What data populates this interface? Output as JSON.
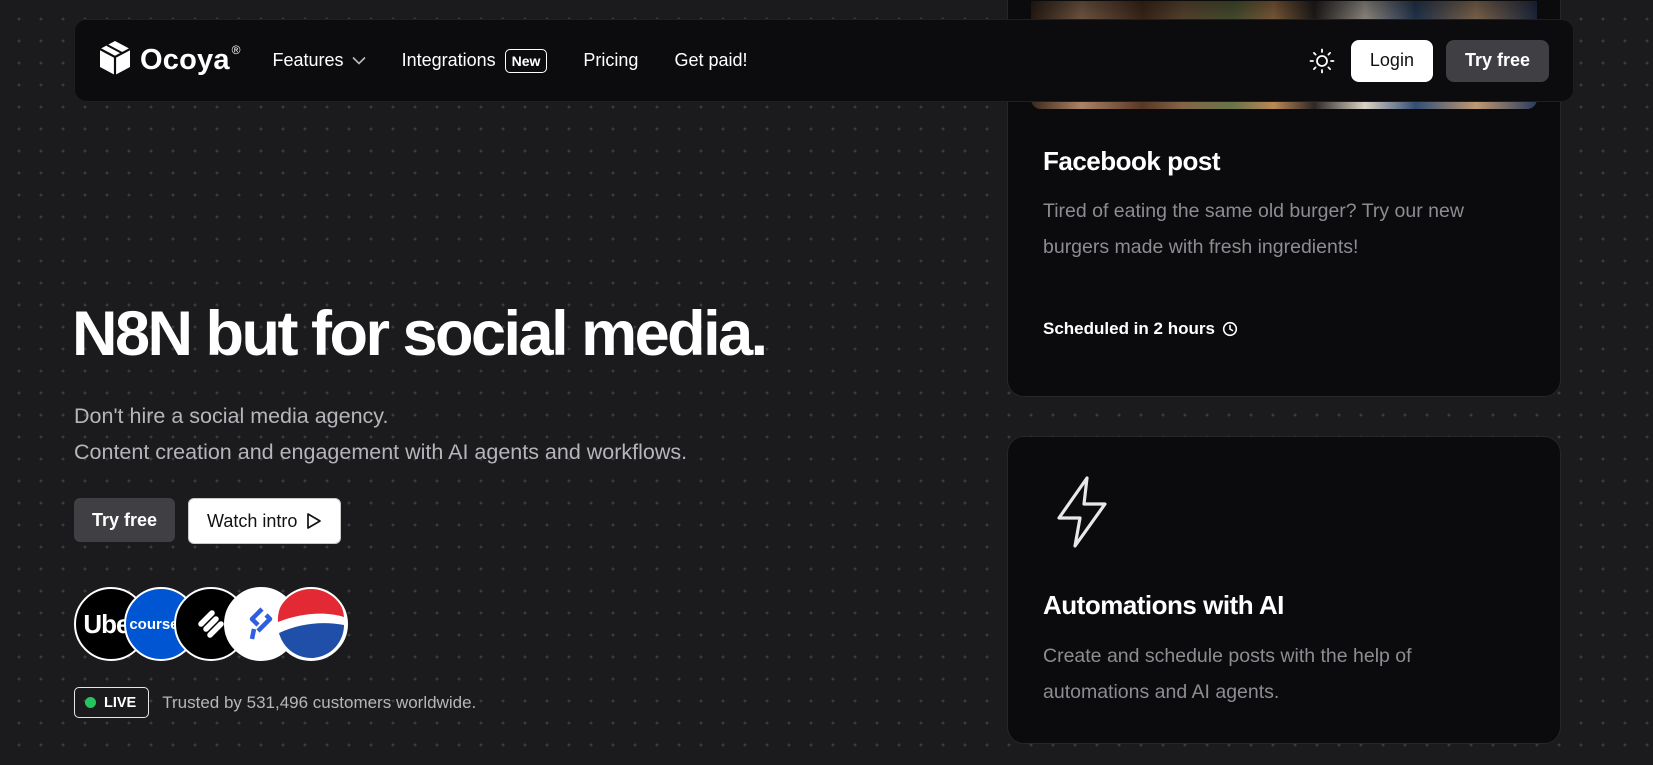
{
  "nav": {
    "brand": "Ocoya",
    "brand_mark": "®",
    "items": [
      {
        "label": "Features"
      },
      {
        "label": "Integrations",
        "badge": "New"
      },
      {
        "label": "Pricing"
      },
      {
        "label": "Get paid!"
      }
    ],
    "login_label": "Login",
    "try_free_label": "Try free"
  },
  "hero": {
    "title": "N8N but for social media.",
    "subtitle_line1": "Don't hire a social media agency.",
    "subtitle_line2": "Content creation and engagement with AI agents and workflows.",
    "try_free_label": "Try free",
    "watch_intro_label": "Watch intro",
    "customer_logos": [
      {
        "name": "Uber",
        "text": "Uber"
      },
      {
        "name": "Coursera",
        "text": "coursera"
      },
      {
        "name": "Squarespace",
        "text": ""
      },
      {
        "name": "Toptal",
        "text": ""
      },
      {
        "name": "Pepsi",
        "text": ""
      }
    ],
    "live_label": "LIVE",
    "trusted_text": "Trusted by 531,496 customers worldwide."
  },
  "cards": {
    "facebook": {
      "title": "Facebook post",
      "text": "Tired of eating the same old burger? Try our new burgers made with fresh ingredients!",
      "scheduled": "Scheduled in 2 hours"
    },
    "automations": {
      "title": "Automations with AI",
      "text": "Create and schedule posts with the help of automations and AI agents."
    }
  },
  "colors": {
    "background": "#1b1b1e",
    "navbar": "#0c0c0e",
    "live_dot": "#22c55e",
    "coursera_blue": "#0056d2",
    "pepsi_red": "#e32934",
    "pepsi_blue": "#1f4fa8"
  }
}
